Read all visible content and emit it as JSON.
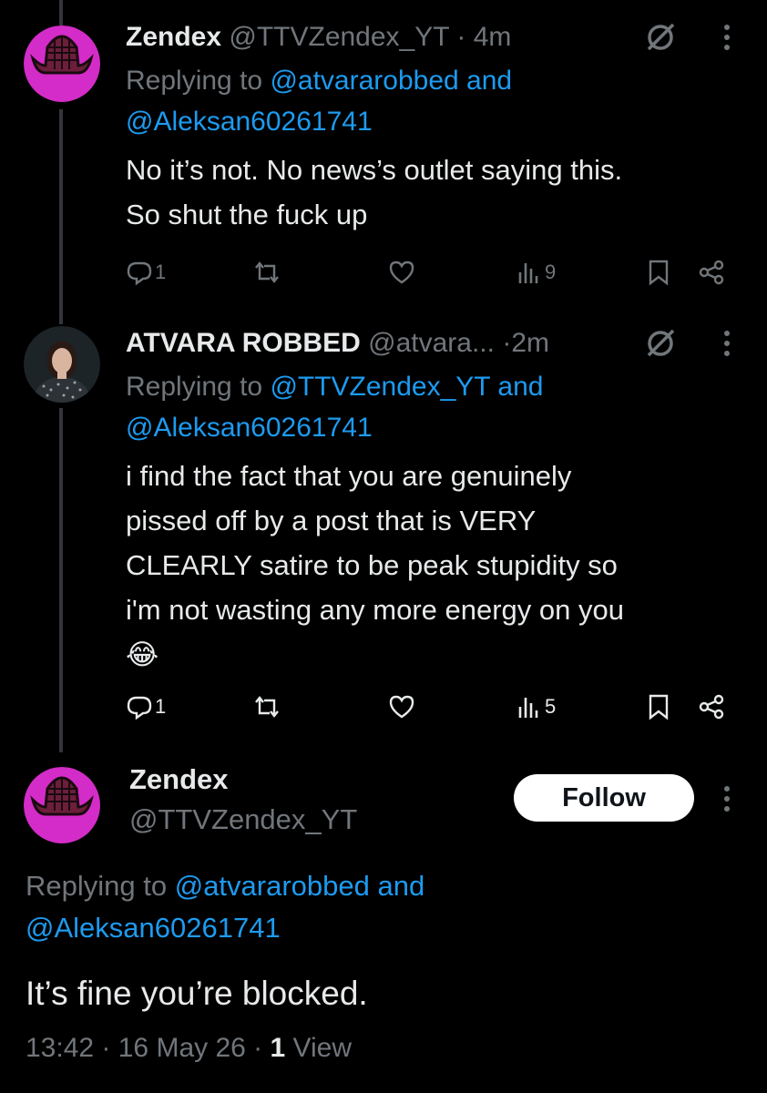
{
  "tweets": [
    {
      "name": "Zendex",
      "handle": "@TTVZendex_YT",
      "separator": "·",
      "time": "4m",
      "replying_prefix": "Replying to ",
      "replying_user1": "@atvararobbed",
      "replying_and": " and",
      "replying_user2": "@Aleksan60261741",
      "text_lines": [
        "No it’s not. No news’s outlet saying this.",
        "So shut the fuck up"
      ],
      "replies": "1",
      "views": "9"
    },
    {
      "name": "ATVARA ROBBED",
      "handle": "@atvara...",
      "separator": "·",
      "time": "2m",
      "replying_prefix": "Replying to ",
      "replying_user1": "@TTVZendex_YT",
      "replying_and": " and",
      "replying_user2": "@Aleksan60261741",
      "text_lines": [
        "i find the fact that you are genuinely",
        "pissed off by a post that is VERY",
        "CLEARLY satire to be peak stupidity so",
        "i'm not wasting any more energy on you",
        "😂"
      ],
      "replies": "1",
      "views": "5"
    }
  ],
  "main_tweet": {
    "name": "Zendex",
    "handle": "@TTVZendex_YT",
    "follow_label": "Follow",
    "replying_prefix": "Replying to ",
    "replying_user1": "@atvararobbed",
    "replying_and": " and",
    "replying_user2": "@Aleksan60261741",
    "text": "It’s fine you’re blocked.",
    "time": "13:42",
    "separator1": " · ",
    "date": "16 May 26",
    "separator2": " · ",
    "view_count": "1",
    "view_label": "View"
  },
  "colors": {
    "background": "#000000",
    "text": "#e7e9ea",
    "muted": "#71767b",
    "link": "#1d9bf0",
    "avatar_zendex": "#d42cc8",
    "thread_line": "#333639"
  },
  "icons": {
    "reply": "reply-icon",
    "retweet": "retweet-icon",
    "like": "heart-icon",
    "views": "views-icon",
    "bookmark": "bookmark-icon",
    "share": "share-icon",
    "grok": "grok-icon",
    "more": "more-icon"
  }
}
